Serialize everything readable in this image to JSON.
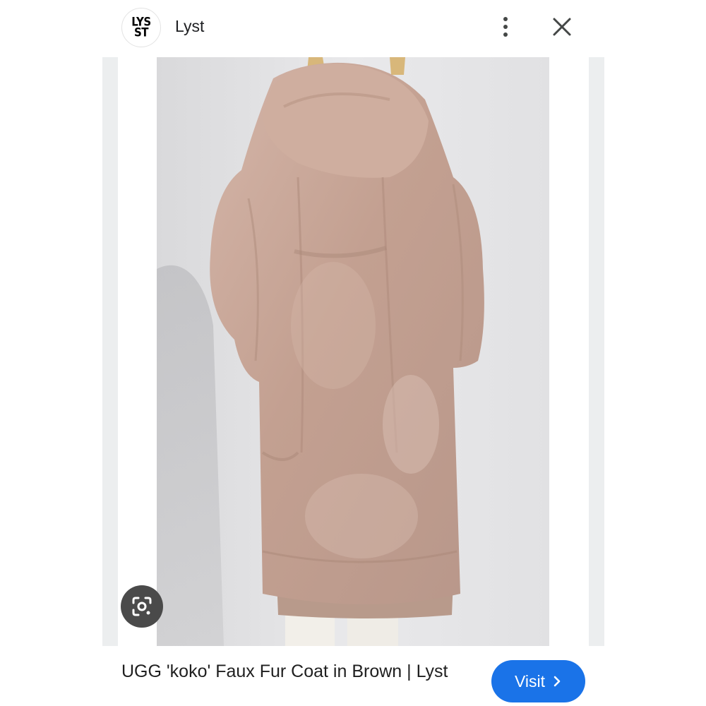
{
  "header": {
    "logo_text": "LYS\nST",
    "site_name": "Lyst",
    "more_icon": "more-vert-icon",
    "close_icon": "close-icon"
  },
  "image": {
    "description_icon": "lens-icon"
  },
  "result": {
    "title": "UGG 'koko' Faux Fur Coat in Brown | Lyst",
    "visit_label": "Visit",
    "visit_icon": "chevron-right-icon"
  },
  "colors": {
    "accent": "#1a73e8",
    "coat": "#c9a99c",
    "background": "#ffffff"
  }
}
